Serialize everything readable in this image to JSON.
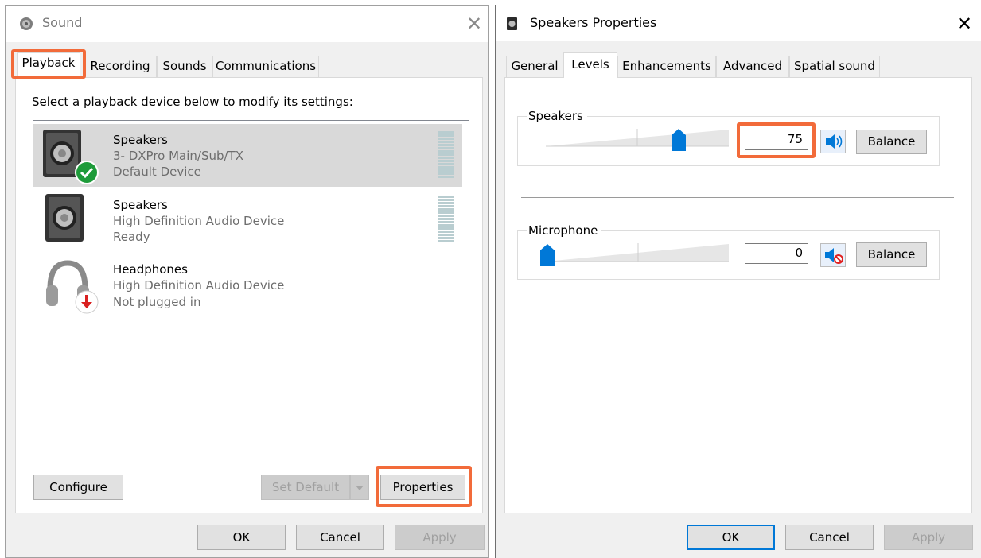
{
  "sound_dialog": {
    "title": "Sound",
    "tabs": [
      "Playback",
      "Recording",
      "Sounds",
      "Communications"
    ],
    "instruction": "Select a playback device below to modify its settings:",
    "devices": [
      {
        "name": "Speakers",
        "line1": "3- DXPro Main/Sub/TX",
        "line2": "Default Device",
        "badge": "check",
        "selected": true
      },
      {
        "name": "Speakers",
        "line1": "High Definition Audio Device",
        "line2": "Ready",
        "badge": "none",
        "selected": false
      },
      {
        "name": "Headphones",
        "line1": "High Definition Audio Device",
        "line2": "Not plugged in",
        "badge": "unplugged",
        "selected": false
      }
    ],
    "buttons": {
      "configure": "Configure",
      "set_default": "Set Default",
      "properties": "Properties",
      "ok": "OK",
      "cancel": "Cancel",
      "apply": "Apply"
    }
  },
  "properties_dialog": {
    "title": "Speakers Properties",
    "tabs": [
      "General",
      "Levels",
      "Enhancements",
      "Advanced",
      "Spatial sound"
    ],
    "speakers": {
      "label": "Speakers",
      "level": 75,
      "value": "75",
      "balance": "Balance"
    },
    "microphone": {
      "label": "Microphone",
      "level": 0,
      "value": "0",
      "balance": "Balance"
    },
    "buttons": {
      "ok": "OK",
      "cancel": "Cancel",
      "apply": "Apply"
    }
  },
  "colors": {
    "highlight": "#f26b3a",
    "accent": "#0078d7",
    "check": "#1e9b3a",
    "alert": "#d92020"
  }
}
